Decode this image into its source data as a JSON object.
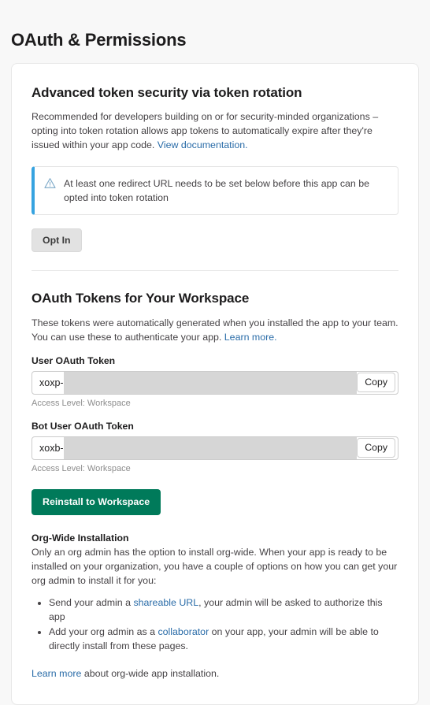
{
  "page": {
    "title": "OAuth & Permissions"
  },
  "token_rotation": {
    "heading": "Advanced token security via token rotation",
    "description_part1": "Recommended for developers building on or for security-minded organizations – opting into token rotation allows app tokens to automatically expire after they're issued within your app code. ",
    "doc_link_label": "View documentation.",
    "alert": {
      "icon": "warning-triangle-icon",
      "text": "At least one redirect URL needs to be set below before this app can be opted into token rotation",
      "border_color": "#36a3e0"
    },
    "opt_in_label": "Opt In"
  },
  "oauth_tokens": {
    "heading": "OAuth Tokens for Your Workspace",
    "description_part1": "These tokens were automatically generated when you installed the app to your team. You can use these to authenticate your app. ",
    "learn_more_label": "Learn more.",
    "fields": [
      {
        "label": "User OAuth Token",
        "prefix": "xoxp-",
        "copy_label": "Copy",
        "access_level": "Access Level: Workspace"
      },
      {
        "label": "Bot User OAuth Token",
        "prefix": "xoxb-",
        "copy_label": "Copy",
        "access_level": "Access Level: Workspace"
      }
    ],
    "reinstall_label": "Reinstall to Workspace",
    "primary_color": "#007a5a"
  },
  "org_wide": {
    "heading": "Org-Wide Installation",
    "description": "Only an org admin has the option to install org-wide. When your app is ready to be installed on your organization, you have a couple of options on how you can get your org admin to install it for you:",
    "bullets": [
      {
        "before": "Send your admin a ",
        "link": "shareable URL",
        "after": ", your admin will be asked to authorize this app"
      },
      {
        "before": "Add your org admin as a ",
        "link": "collaborator",
        "after": " on your app, your admin will be able to directly install from these pages."
      }
    ],
    "footer_link_label": "Learn more",
    "footer_text_after": " about org-wide app installation."
  },
  "colors": {
    "link": "#2a6ca8",
    "page_background": "#f8f8f8",
    "card_background": "#ffffff",
    "redaction": "#d6d6d6"
  }
}
